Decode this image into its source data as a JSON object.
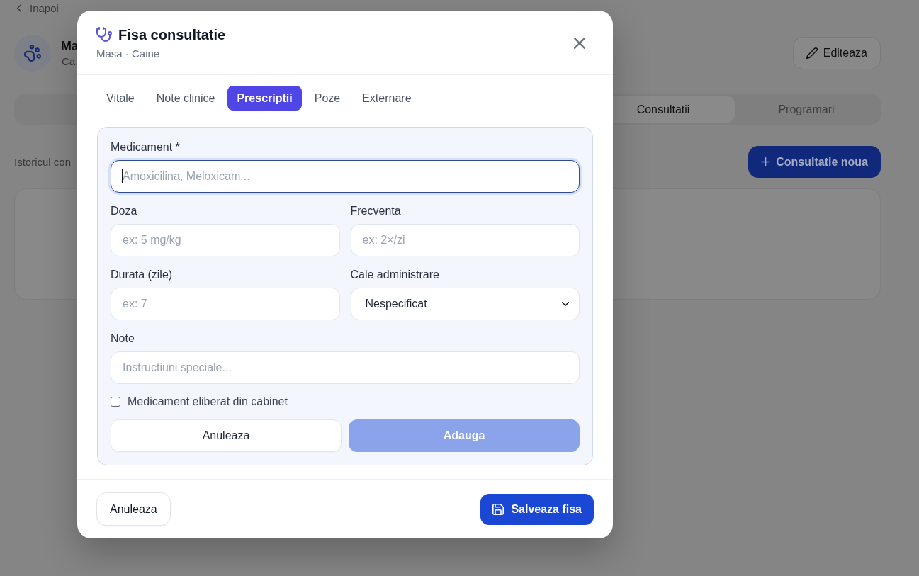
{
  "background_page": {
    "back_link": {
      "label": "Inapoi"
    },
    "pet": {
      "name": "Ma",
      "subtitle": "Ca"
    },
    "edit_button": {
      "label": "Editeaza"
    },
    "tabs": [
      {
        "label": "Consultatii",
        "selected": true
      },
      {
        "label": "Programari",
        "selected": false
      }
    ],
    "history_heading": "Istoricul con",
    "new_button": {
      "label": "Consultatie noua"
    }
  },
  "modal": {
    "title": "Fisa consultatie",
    "subtitle": "Masa · Caine",
    "tabs": [
      {
        "label": "Vitale",
        "selected": false
      },
      {
        "label": "Note clinice",
        "selected": false
      },
      {
        "label": "Prescriptii",
        "selected": true
      },
      {
        "label": "Poze",
        "selected": false
      },
      {
        "label": "Externare",
        "selected": false
      }
    ],
    "form": {
      "rows": [
        [
          {
            "kind": "text",
            "label": "Medicament *",
            "placeholder": "Amoxicilina, Meloxicam...",
            "focused": true
          }
        ],
        [
          {
            "kind": "text",
            "label": "Doza",
            "placeholder": "ex: 5 mg/kg",
            "focused": false
          },
          {
            "kind": "text",
            "label": "Frecventa",
            "placeholder": "ex: 2×/zi",
            "focused": false
          }
        ],
        [
          {
            "kind": "text",
            "label": "Durata (zile)",
            "placeholder": "ex: 7",
            "focused": false
          },
          {
            "kind": "select",
            "label": "Cale administrare",
            "value": "Nespecificat",
            "focused": false
          }
        ],
        [
          {
            "kind": "text",
            "label": "Note",
            "placeholder": "Instructiuni speciale...",
            "focused": false
          }
        ]
      ],
      "checkbox": {
        "label": "Medicament eliberat din cabinet",
        "checked": false
      },
      "cancel_button": {
        "label": "Anuleaza"
      },
      "add_button": {
        "label": "Adauga",
        "disabled": true
      }
    },
    "footer": {
      "cancel_button": {
        "label": "Anuleaza"
      },
      "save_button": {
        "label": "Salveaza fisa"
      }
    }
  }
}
